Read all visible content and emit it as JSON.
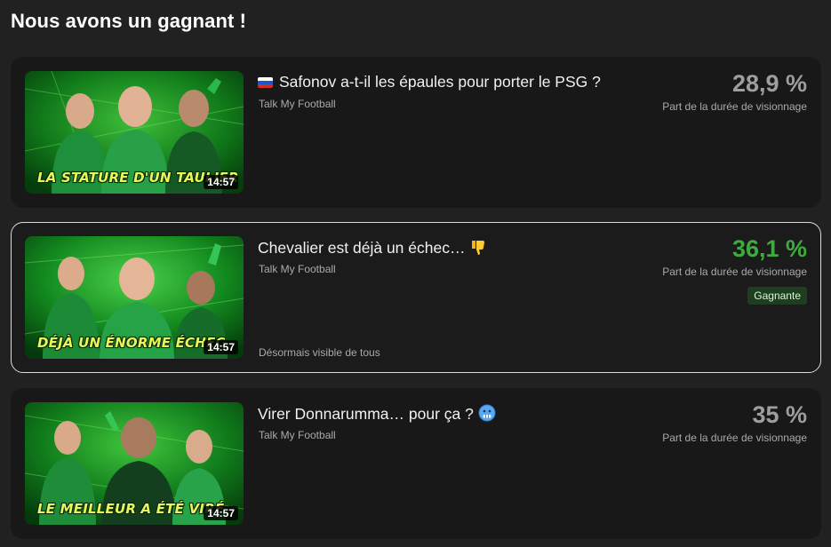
{
  "page": {
    "title": "Nous avons un gagnant !"
  },
  "videos": [
    {
      "title": "Safonov a-t-il les épaules pour porter le PSG ?",
      "title_icon": "russia-flag-icon",
      "channel": "Talk My Football",
      "duration": "14:57",
      "thumbnail_caption": "LA STATURE D'UN TAULIER",
      "stat_value": "28,9 %",
      "stat_label": "Part de la durée de visionnage",
      "winner": false,
      "stat_color": "#9e9e9e"
    },
    {
      "title": "Chevalier est déjà un échec…",
      "title_icon": "thumbs-down-icon",
      "channel": "Talk My Football",
      "duration": "14:57",
      "thumbnail_caption": "DÉJÀ UN ÉNORME ÉCHEC",
      "stat_value": "36,1 %",
      "stat_label": "Part de la durée de visionnage",
      "winner": true,
      "badge": "Gagnante",
      "note": "Désormais visible de tous",
      "stat_color": "#3dab3d"
    },
    {
      "title": "Virer Donnarumma… pour ça ?",
      "title_icon": "cold-face-icon",
      "channel": "Talk My Football",
      "duration": "14:57",
      "thumbnail_caption": "LE MEILLEUR A ÉTÉ VIRÉ",
      "stat_value": "35 %",
      "stat_label": "Part de la durée de visionnage",
      "winner": false,
      "stat_color": "#9e9e9e"
    }
  ],
  "colors": {
    "background": "#212121",
    "card": "#181818",
    "winner_border": "#dcdcdc",
    "winner_green": "#3dab3d",
    "badge_bg": "#1f3d1f"
  }
}
